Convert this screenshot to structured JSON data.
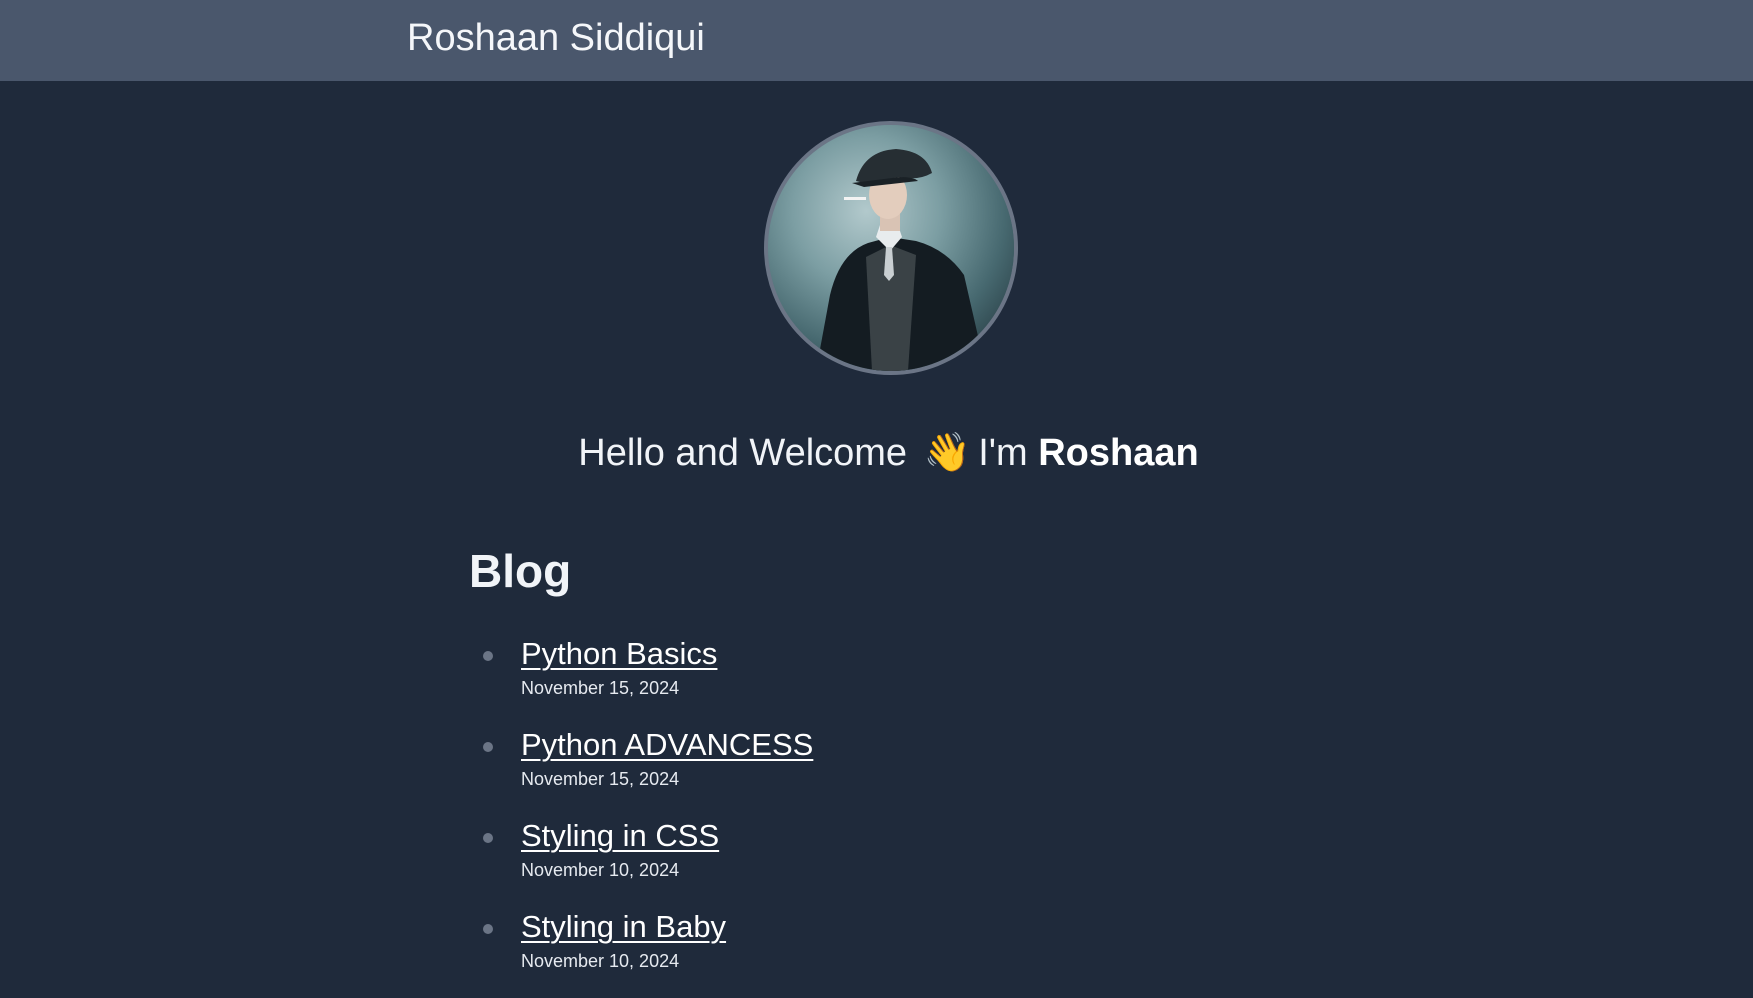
{
  "header": {
    "site_title": "Roshaan Siddiqui"
  },
  "hero": {
    "avatar_alt": "Profile photo",
    "greeting_prefix": "Hello and Welcome",
    "wave_emoji": "👋",
    "greeting_mid": "I'm",
    "name": "Roshaan"
  },
  "blog": {
    "heading": "Blog",
    "posts": [
      {
        "title": "Python Basics",
        "date": "November 15, 2024"
      },
      {
        "title": "Python ADVANCESS",
        "date": "November 15, 2024"
      },
      {
        "title": "Styling in CSS",
        "date": "November 10, 2024"
      },
      {
        "title": "Styling in Baby",
        "date": "November 10, 2024"
      }
    ]
  },
  "colors": {
    "background": "#1f2a3b",
    "header": "#4a576c",
    "text": "#f1f4f8",
    "bullet": "#6b7586"
  }
}
